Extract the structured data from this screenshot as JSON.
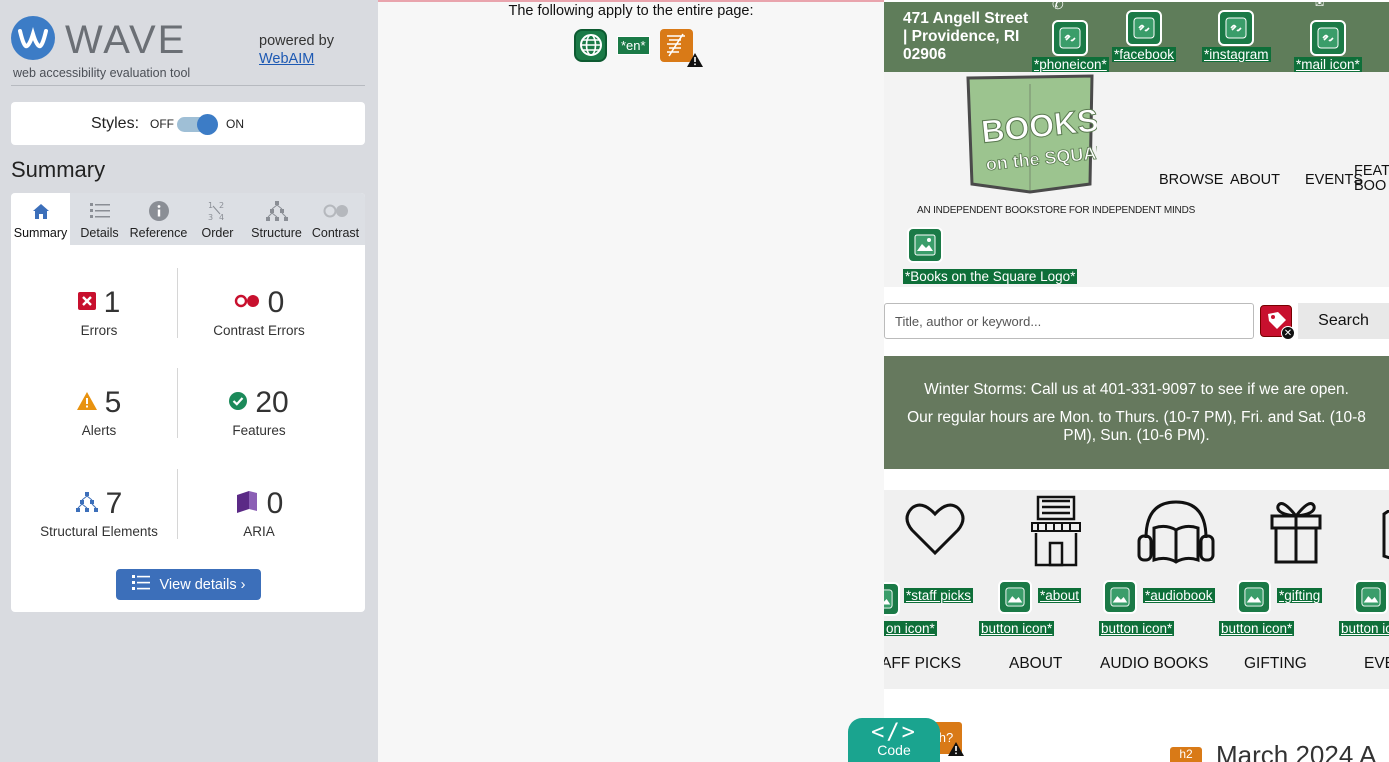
{
  "wave": {
    "logo_word": "WAVE",
    "tagline": "web accessibility evaluation tool",
    "powered_by": "powered by",
    "webaim_link": "WebAIM",
    "styles_label": "Styles:",
    "styles_off": "OFF",
    "styles_on": "ON",
    "summary_heading": "Summary",
    "tabs": [
      {
        "label": "Summary",
        "icon": "home-icon"
      },
      {
        "label": "Details",
        "icon": "list-icon"
      },
      {
        "label": "Reference",
        "icon": "info-icon"
      },
      {
        "label": "Order",
        "icon": "order-icon"
      },
      {
        "label": "Structure",
        "icon": "structure-icon"
      },
      {
        "label": "Contrast",
        "icon": "contrast-icon"
      }
    ],
    "stats": {
      "errors": {
        "count": "1",
        "label": "Errors"
      },
      "contrast_errors": {
        "count": "0",
        "label": "Contrast Errors"
      },
      "alerts": {
        "count": "5",
        "label": "Alerts"
      },
      "features": {
        "count": "20",
        "label": "Features"
      },
      "structural": {
        "count": "7",
        "label": "Structural Elements"
      },
      "aria": {
        "count": "0",
        "label": "ARIA"
      }
    },
    "view_details": "View details ›",
    "colors": {
      "accent": "#3c7cc6",
      "error": "#c8102e",
      "alert": "#e8920f",
      "feature": "#1b8a5a",
      "aria": "#5b2a86"
    }
  },
  "middle": {
    "page_apply": "The following apply to the entire page:",
    "lang_tag": "*en*",
    "code_button": "Code",
    "code_symbol": "</>",
    "heading_badge": "h?"
  },
  "site": {
    "address": "471 Angell Street | Providence, RI 02906",
    "social": [
      {
        "label": "*phoneicon*"
      },
      {
        "label": "*facebook"
      },
      {
        "label": "*instagram"
      },
      {
        "label": "*mail icon*"
      }
    ],
    "logo_text_main": "BOOKS",
    "logo_text_sub": "on the SQUARE",
    "tagline": "AN INDEPENDENT BOOKSTORE FOR INDEPENDENT MINDS",
    "nav": [
      "BROWSE",
      "ABOUT",
      "EVENTS",
      "FEATU BOO"
    ],
    "logo_alt": "*Books on the Square Logo*",
    "search_placeholder": "Title, author or keyword...",
    "search_button": "Search",
    "notice_line1": "Winter Storms: Call us at 401-331-9097 to see if we are open.",
    "notice_line2": "Our regular hours are Mon. to Thurs. (10-7 PM), Fri. and Sat. (10-8 PM), Sun. (10-6 PM).",
    "categories": [
      {
        "name": "AFF PICKS",
        "alt1": "*staff picks",
        "alt2": "on icon*"
      },
      {
        "name": "ABOUT",
        "alt1": "*about",
        "alt2": "button icon*"
      },
      {
        "name": "AUDIO BOOKS",
        "alt1": "*audiobook",
        "alt2": "button icon*"
      },
      {
        "name": "GIFTING",
        "alt1": "*gifting",
        "alt2": "button icon*"
      },
      {
        "name": "EVE",
        "alt1": "",
        "alt2": "button ico"
      }
    ],
    "h2_badge": "h2",
    "heading": "March 2024 A"
  }
}
